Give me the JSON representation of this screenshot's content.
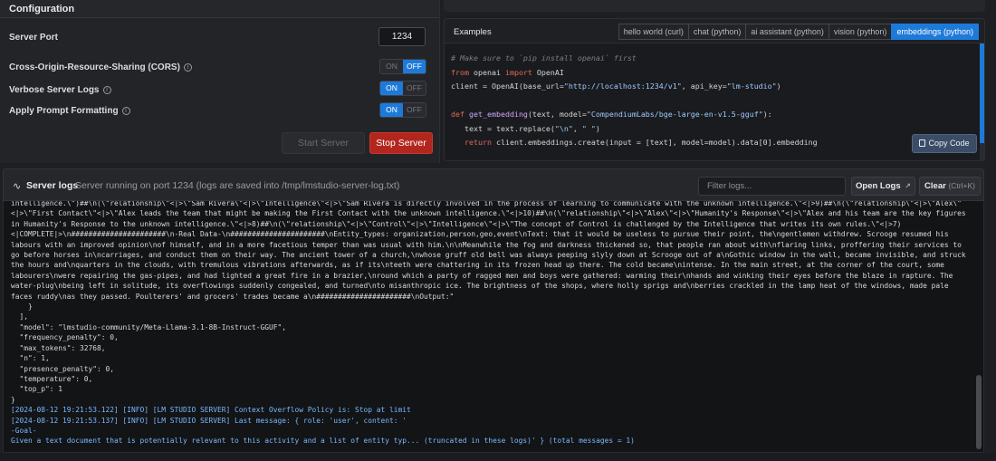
{
  "config": {
    "title": "Configuration",
    "server_port_label": "Server Port",
    "server_port_value": "1234",
    "cors_label": "Cross-Origin-Resource-Sharing (CORS)",
    "cors_state": "off",
    "verbose_label": "Verbose Server Logs",
    "verbose_state": "on",
    "prompt_format_label": "Apply Prompt Formatting",
    "prompt_format_state": "on",
    "toggle_on_label": "ON",
    "toggle_off_label": "OFF",
    "info_glyph": "i",
    "start_label": "Start Server",
    "stop_label": "Stop Server"
  },
  "examples": {
    "title": "Examples",
    "tabs": [
      {
        "label": "hello world (curl)",
        "active": false
      },
      {
        "label": "chat (python)",
        "active": false
      },
      {
        "label": "ai assistant (python)",
        "active": false
      },
      {
        "label": "vision (python)",
        "active": false
      },
      {
        "label": "embeddings (python)",
        "active": true
      }
    ],
    "copy_label": "Copy Code",
    "code": {
      "comment": "# Make sure to `pip install openai` first",
      "kw_from": "from",
      "mod_openai": " openai ",
      "kw_import": "import",
      "import_name": " OpenAI",
      "client_prefix": "client = OpenAI(base_url=",
      "base_url": "\"http://localhost:1234/v1\"",
      "api_key_prefix": ", api_key=",
      "api_key": "\"lm-studio\"",
      "close_paren": ")",
      "kw_def": "def",
      "fn_name": " get_embedding",
      "def_args_a": "(text, model=",
      "model_str": "\"CompendiumLabs/bge-large-en-v1.5-gguf\"",
      "def_args_b": "):",
      "replace_a": "   text = text.replace(",
      "replace_nl": "\"\\n\"",
      "replace_comma": ", ",
      "replace_sp": "\" \"",
      "replace_b": ")",
      "kw_return": "   return",
      "return_rest": " client.embeddings.create(input = [text], model=model).data[0].embedding",
      "partial_line": "                        "
    }
  },
  "logs": {
    "icon": "∿",
    "title": "Server logs",
    "subtitle": "Server running on port 1234 (logs are saved into /tmp/lmstudio-server-log.txt)",
    "filter_placeholder": "Filter logs...",
    "open_logs_label": "Open Logs",
    "open_logs_icon": "↗",
    "clear_label": "Clear",
    "clear_shortcut": "(Ctrl+K)",
    "body_text": "intelligence.\\\")##\\n(\\\"relationship\\\"<|>\\\"Sam Rivera\\\"<|>\\\"Intelligence\\\"<|>\\\"Sam Rivera is directly involved in the process of learning to communicate with the unknown intelligence.\\\"<|>9)##\\n(\\\"relationship\\\"<|>\\\"Alex\\\"<|>\\\"First Contact\\\"<|>\\\"Alex leads the team that might be making the First Contact with the unknown intelligence.\\\"<|>10)##\\n(\\\"relationship\\\"<|>\\\"Alex\\\"<|>\\\"Humanity's Response\\\"<|>\\\"Alex and his team are the key figures in Humanity's Response to the unknown intelligence.\\\"<|>8)##\\n(\\\"relationship\\\"<|>\\\"Control\\\"<|>\\\"Intelligence\\\"<|>\\\"The concept of Control is challenged by the Intelligence that writes its own rules.\\\"<|>7)\n<|COMPLETE|>\\n######################\\n-Real Data-\\n######################\\nEntity_types: organization,person,geo,event\\nText: that it would be useless to pursue their point, the\\ngentlemen withdrew. Scrooge resumed his labours with an improved opinion\\nof himself, and in a more facetious temper than was usual with him.\\n\\nMeanwhile the fog and darkness thickened so, that people ran about with\\nflaring links, proffering their services to go before horses in\\ncarriages, and conduct them on their way. The ancient tower of a church,\\nwhose gruff old bell was always peeping slyly down at Scrooge out of a\\nGothic window in the wall, became invisible, and struck the hours and\\nquarters in the clouds, with tremulous vibrations afterwards, as if its\\nteeth were chattering in its frozen head up there. The cold became\\nintense. In the main street, at the corner of the court, some labourers\\nwere repairing the gas-pipes, and had lighted a great fire in a brazier,\\nround which a party of ragged men and boys were gathered: warming their\\nhands and winking their eyes before the blaze in rapture. The water-plug\\nbeing left in solitude, its overflowings suddenly congealed, and turned\\nto misanthropic ice. The brightness of the shops, where holly sprigs and\\nberries crackled in the lamp heat of the windows, made pale faces ruddy\\nas they passed. Poulterers' and grocers' trades became a\\n######################\\nOutput:\"\n    }\n  ],\n  \"model\": \"lmstudio-community/Meta-Llama-3.1-8B-Instruct-GGUF\",\n  \"frequency_penalty\": 0,\n  \"max_tokens\": 32768,\n  \"n\": 1,\n  \"presence_penalty\": 0,\n  \"temperature\": 0,\n  \"top_p\": 1\n}",
    "line_1": "[2024-08-12 19:21:53.122] [INFO] [LM STUDIO SERVER] Context Overflow Policy is: Stop at limit",
    "line_2": "[2024-08-12 19:21:53.137] [INFO] [LM STUDIO SERVER] Last message: { role: 'user', content: '",
    "line_3": "-Goal-",
    "line_4": "Given a text document that is potentially relevant to this activity and a list of entity typ... (truncated in these logs)' } (total messages = 1)"
  },
  "colors": {
    "accent_blue": "#1e7ad9",
    "stop_red": "#b3261e",
    "log_blue": "#79b8ff"
  }
}
